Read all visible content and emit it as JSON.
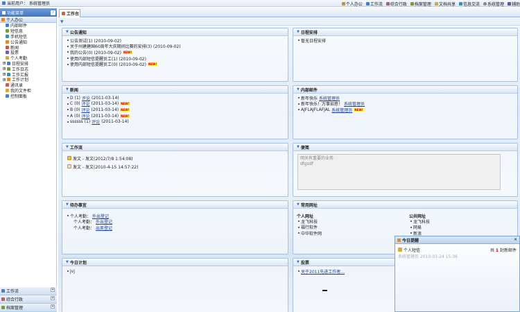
{
  "topbar": {
    "user_label": "当前用户：",
    "user_value": "系统管理员",
    "tools": [
      {
        "label": "个人办公",
        "icon": "person-icon",
        "color": "#e28a2b"
      },
      {
        "label": "工作流",
        "icon": "document-icon",
        "color": "#4a7fc1"
      },
      {
        "label": "综合行政",
        "icon": "building-icon",
        "color": "#c45a5a"
      },
      {
        "label": "档案管理",
        "icon": "archive-icon",
        "color": "#7b9a3a"
      },
      {
        "label": "文档共享",
        "icon": "folder-icon",
        "color": "#d8a83a"
      },
      {
        "label": "信息交流",
        "icon": "chat-icon",
        "color": "#3a8fb8"
      },
      {
        "label": "系统管理",
        "icon": "gear-icon",
        "color": "#888888"
      },
      {
        "label": "辅助",
        "icon": "help-icon",
        "color": "#5a5a9a"
      }
    ]
  },
  "menubar": {
    "title": "功能菜单",
    "collapse": "«"
  },
  "sidebar": {
    "section": "个人办公",
    "items": [
      {
        "label": "内部邮件",
        "icon": "mail-icon",
        "color": "#4a7fc1",
        "level": 2
      },
      {
        "label": "短信息",
        "icon": "sms-icon",
        "color": "#7b9a3a",
        "level": 2
      },
      {
        "label": "手机短信",
        "icon": "phone-icon",
        "color": "#3a8fb8",
        "level": 2
      },
      {
        "label": "公告通知",
        "icon": "notice-icon",
        "color": "#e28a2b",
        "level": 2
      },
      {
        "label": "新闻",
        "icon": "news-icon",
        "color": "#c45a5a",
        "level": 2
      },
      {
        "label": "投票",
        "icon": "vote-icon",
        "color": "#7a5ab0",
        "level": 2
      },
      {
        "label": "个人考勤",
        "icon": "clock-icon",
        "color": "#d8a83a",
        "level": 2
      },
      {
        "label": "日程安排",
        "icon": "calendar-icon",
        "color": "#4a7fc1",
        "level": 1,
        "expand": "+"
      },
      {
        "label": "工作日志",
        "icon": "log-icon",
        "color": "#7b9a3a",
        "level": 1,
        "expand": "+"
      },
      {
        "label": "工作汇报",
        "icon": "report-icon",
        "color": "#3a8fb8",
        "level": 1,
        "expand": "+"
      },
      {
        "label": "工作计划",
        "icon": "plan-icon",
        "color": "#e28a2b",
        "level": 1,
        "expand": "+"
      },
      {
        "label": "通讯录",
        "icon": "contacts-icon",
        "color": "#c45a5a",
        "level": 2
      },
      {
        "label": "我的文件柜",
        "icon": "cabinet-icon",
        "color": "#d8a83a",
        "level": 2
      },
      {
        "label": "控制面板",
        "icon": "control-panel-icon",
        "color": "#4a7fc1",
        "level": 2
      }
    ],
    "bottom": [
      {
        "label": "工作流",
        "icon": "document-icon",
        "color": "#4a7fc1"
      },
      {
        "label": "综合行政",
        "icon": "building-icon",
        "color": "#c45a5a"
      },
      {
        "label": "档案管理",
        "icon": "archive-icon",
        "color": "#7b9a3a"
      }
    ],
    "toggle": "+"
  },
  "tab": {
    "label": "工作台"
  },
  "panels": {
    "announcements": {
      "title": "公告通知",
      "items": [
        {
          "text": "公告测试(1) (2010-09-02)",
          "new": false
        },
        {
          "text": "关于州建建国60周年大庆期间比赛的安排(3) (2010-09-02)",
          "new": false
        },
        {
          "text": "我的公告(0) (2010-09-02)",
          "new": true
        },
        {
          "text": "使用内部短信提醒员工(1) (2010-09-02)",
          "new": false
        },
        {
          "text": "使用内部短信提醒员工(0) (2010-09-02)",
          "new": true
        }
      ]
    },
    "schedule": {
      "title": "日程安排",
      "items": [
        "暂无日程安排"
      ]
    },
    "news": {
      "title": "新闻",
      "items": [
        {
          "pre": "D (1)",
          "link": "评论",
          "post": "(2011-03-14)",
          "new": false
        },
        {
          "pre": "C (0)",
          "link": "评论",
          "post": "(2011-03-14)",
          "new": true
        },
        {
          "pre": "B (0)",
          "link": "评论",
          "post": "(2011-03-14)",
          "new": true
        },
        {
          "pre": "A (0)",
          "link": "评论",
          "post": "(2011-03-14)",
          "new": true
        },
        {
          "pre": "ssssss (1)",
          "link": "评论",
          "post": "(2011-03-14)",
          "new": false
        }
      ]
    },
    "mail": {
      "title": "内部邮件",
      "items": [
        {
          "pre": "新年快乐",
          "link": "系统管理员",
          "new": false
        },
        {
          "pre": "新年快乐！万事如意！",
          "link": "系统管理员",
          "new": false
        },
        {
          "pre": "AJFLAJFLAFJAL",
          "link": "系统管理员",
          "new": true
        }
      ]
    },
    "workflow": {
      "title": "工作流",
      "items": [
        {
          "text": "发文 - 发文(2012/7/8 1:54:08)",
          "icon": "envelope-icon"
        },
        {
          "text": "发文 - 发文(2010-4-15 14:57:22)",
          "icon": "page-icon"
        }
      ]
    },
    "memo": {
      "title": "便笺",
      "lines": [
        "明天有重要的业务",
        "dfgsdf"
      ]
    },
    "todo": {
      "title": "待办事宜",
      "items": [
        {
          "pre": "个人考勤：",
          "link": "外出登记"
        },
        {
          "pre": "个人考勤：",
          "link": "外出登记"
        },
        {
          "pre": "个人考勤：",
          "link": "出差登记"
        }
      ]
    },
    "links": {
      "title": "常用网址",
      "personal_title": "个人网址",
      "personal": [
        "龙飞科技",
        "福行软件",
        "中华软件网"
      ],
      "public_title": "公共网址",
      "public": [
        "龙飞科技",
        "网易",
        "新浪"
      ]
    },
    "plan": {
      "title": "今日计划",
      "items": [
        "jvj"
      ]
    },
    "vote": {
      "title": "投票",
      "items": [
        "关于2011先进工作者..."
      ]
    }
  },
  "popup": {
    "title": "今日提醒",
    "close": "×",
    "row_label": "个人短信",
    "count_pre": "共",
    "count_num": "1",
    "count_post": "封新邮件",
    "faded_line": "系统管理员 2010-03-24 15:36"
  }
}
